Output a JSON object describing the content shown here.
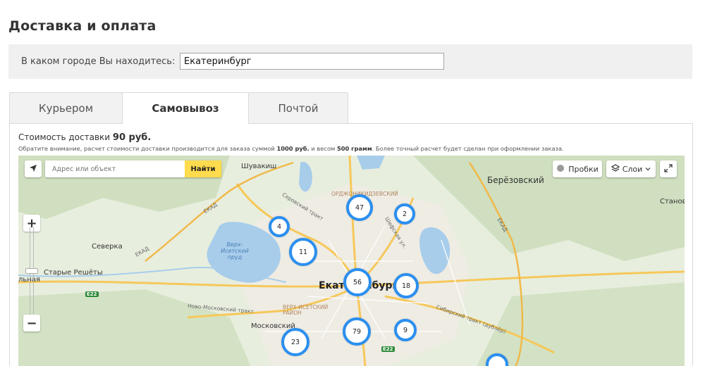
{
  "page": {
    "title": "Доставка и оплата"
  },
  "city": {
    "label": "В каком городе Вы находитесь:",
    "value": "Екатеринбург"
  },
  "tabs": [
    {
      "label": "Курьером",
      "active": false
    },
    {
      "label": "Самовывоз",
      "active": true
    },
    {
      "label": "Почтой",
      "active": false
    }
  ],
  "delivery": {
    "cost_prefix": "Стоимость доставки",
    "cost_value": "90 руб.",
    "note_part1": "Обратите внимание, расчет стоимости доставки производится для заказа суммой",
    "note_sum": "1000 руб.",
    "note_part2": "и весом",
    "note_weight": "500 грамм",
    "note_part3": ". Более точный расчет будет сделан при оформлении заказа."
  },
  "map": {
    "search_placeholder": "Адрес или объект",
    "search_button": "Найти",
    "traffic_button": "Пробки",
    "layers_button": "Слои",
    "zoom_in": "+",
    "zoom_out": "−",
    "clusters": [
      "47",
      "2",
      "4",
      "11",
      "56",
      "18",
      "79",
      "9",
      "23"
    ],
    "places": {
      "berezovsky": "Берёзовский",
      "shuvakish": "Шувакиш",
      "severka": "Северка",
      "starye_reshyoty": "Старые Решёты",
      "lnaya": "льная",
      "moskovsky": "Московский",
      "ekaterinburg": "Екатеринбург",
      "stanov": "Станов",
      "ordzhonikidzevsky": "ОРДЖОНИКИДЗЕВСКИЙ",
      "verkh_isetsky": "ВЕРХ-ИСЕТСКИЙ РАЙОН",
      "verkh_isetsky_pond": "Верх-Исетский пруд",
      "ekad": "ЕКАД",
      "serovsky_trakt": "Серовский тракт",
      "shefskaya": "Шефская ул.",
      "novo_moskovsky": "Ново-Московский тракт",
      "sibirsky_trakt": "Сибирский тракт (дублёр)",
      "e22": "E22"
    }
  },
  "colors": {
    "cluster_ring": "#2b8fef",
    "road_yellow": "#f6c85a",
    "water": "#a8cdeb",
    "search_button": "#ffdb4d"
  }
}
